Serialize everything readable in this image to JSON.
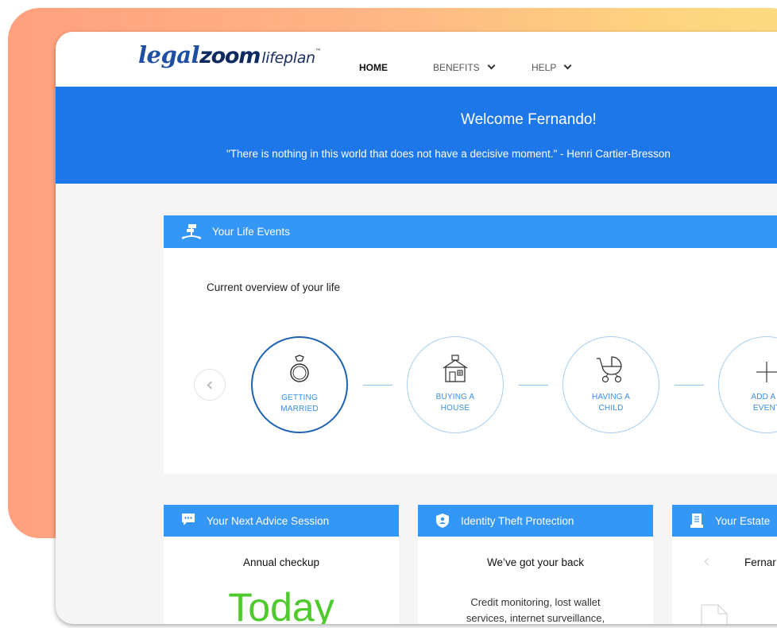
{
  "brand": {
    "part1": "legal",
    "part2": "zoom",
    "part3": "lifeplan",
    "tm": "™"
  },
  "nav": {
    "home": "HOME",
    "benefits": "BENEFITS",
    "help": "HELP"
  },
  "hero": {
    "title": "Welcome Fernando!",
    "quote": "\"There is nothing in this world that does not have a decisive moment.\"  -  Henri Cartier-Bresson"
  },
  "life_events": {
    "header": "Your Life Events",
    "subtitle": "Current overview of your life",
    "events": [
      {
        "label_line1": "GETTING",
        "label_line2": "MARRIED",
        "icon": "ring-icon"
      },
      {
        "label_line1": "BUYING A",
        "label_line2": "HOUSE",
        "icon": "house-icon"
      },
      {
        "label_line1": "HAVING A",
        "label_line2": "CHILD",
        "icon": "stroller-icon"
      },
      {
        "label_line1": "ADD A L",
        "label_line2": "EVENT",
        "icon": "plus-icon"
      }
    ]
  },
  "advice": {
    "header": "Your Next Advice Session",
    "title": "Annual checkup",
    "value": "Today"
  },
  "identity": {
    "header": "Identity Theft Protection",
    "title": "We’ve got your back",
    "line1": "Credit monitoring, lost wallet",
    "line2": "services, internet surveillance,"
  },
  "estate": {
    "header": "Your Estate",
    "name": "Fernar"
  },
  "colors": {
    "hero_blue": "#1e77e8",
    "card_header_blue": "#3496f5",
    "accent_green": "#4ecb2c",
    "brand_navy": "#1f4fa3"
  }
}
